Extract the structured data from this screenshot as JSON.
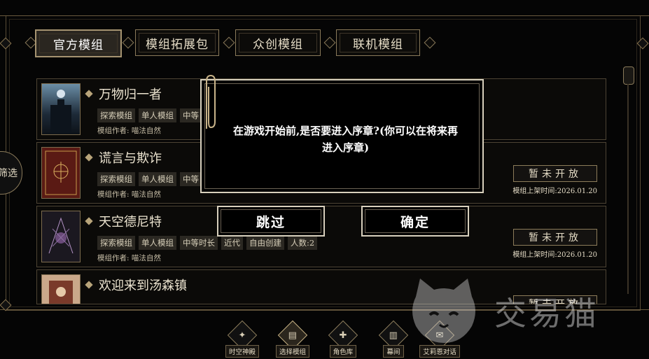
{
  "tabs": [
    {
      "label": "官方模组",
      "active": true
    },
    {
      "label": "模组拓展包",
      "active": false
    },
    {
      "label": "众创模组",
      "active": false
    },
    {
      "label": "联机模组",
      "active": false
    }
  ],
  "filter_label": "筛选",
  "mods": [
    {
      "title": "万物归一者",
      "tags": [
        "探索模组",
        "单人模组",
        "中等"
      ],
      "author": "模组作者: 喵法自然"
    },
    {
      "title": "谎言与欺诈",
      "tags": [
        "探索模组",
        "单人模组",
        "中等"
      ],
      "author": "模组作者: 喵法自然",
      "status": "暂未开放",
      "release": "模组上架时间:2026.01.20"
    },
    {
      "title": "天空德尼特",
      "tags": [
        "探索模组",
        "单人模组",
        "中等时长",
        "近代",
        "自由创建",
        "人数:2"
      ],
      "author": "模组作者: 喵法自然",
      "status": "暂未开放",
      "release": "模组上架时间:2026.01.20"
    },
    {
      "title": "欢迎来到汤森镇",
      "tags": [],
      "author": "",
      "status": "暂未开放"
    }
  ],
  "dialog": {
    "message": "在游戏开始前,是否要进入序章?(你可以在将来再进入序章)",
    "skip_label": "跳过",
    "confirm_label": "确定"
  },
  "nav": [
    {
      "label": "时空神殿",
      "icon": "compass-icon",
      "active": false
    },
    {
      "label": "选择模组",
      "icon": "cards-icon",
      "active": true
    },
    {
      "label": "角色库",
      "icon": "character-card-icon",
      "active": false
    },
    {
      "label": "幕间",
      "icon": "stage-icon",
      "active": false
    },
    {
      "label": "艾莉恩对话",
      "icon": "chat-icon",
      "active": false
    }
  ],
  "watermark": "交易猫"
}
